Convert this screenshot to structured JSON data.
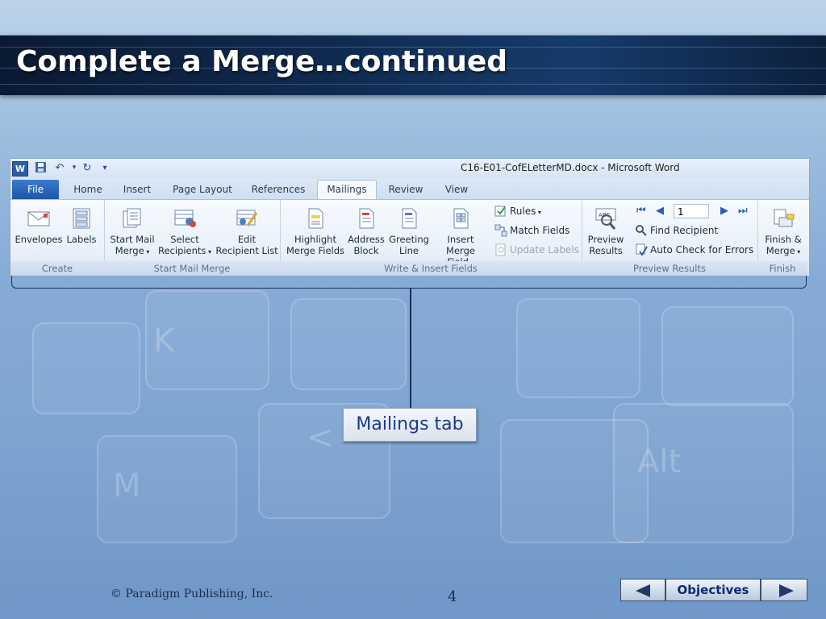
{
  "slide": {
    "title": "Complete a Merge…continued",
    "callout": "Mailings tab",
    "footer": "© Paradigm Publishing, Inc.",
    "page_number": "4",
    "nav": {
      "objectives_label": "Objectives",
      "prev_icon": "triangle-left-icon",
      "next_icon": "triangle-right-icon"
    }
  },
  "word": {
    "window_title": "C16-E01-CofELetterMD.docx - Microsoft Word",
    "qat_icons": [
      "word-app-icon",
      "save-icon",
      "undo-icon",
      "redo-icon",
      "customize-qat-icon"
    ],
    "tabs": [
      "File",
      "Home",
      "Insert",
      "Page Layout",
      "References",
      "Mailings",
      "Review",
      "View"
    ],
    "active_tab": "Mailings",
    "groups": {
      "create": {
        "label": "Create",
        "envelopes": "Envelopes",
        "labels": "Labels"
      },
      "start_mail_merge": {
        "label": "Start Mail Merge",
        "start_mail_merge": [
          "Start Mail",
          "Merge"
        ],
        "select_recipients": [
          "Select",
          "Recipients"
        ],
        "edit_recipient_list": [
          "Edit",
          "Recipient List"
        ]
      },
      "write_insert": {
        "label": "Write & Insert Fields",
        "highlight": [
          "Highlight",
          "Merge Fields"
        ],
        "address_block": [
          "Address",
          "Block"
        ],
        "greeting_line": [
          "Greeting",
          "Line"
        ],
        "insert_merge_field": [
          "Insert Merge",
          "Field"
        ],
        "rules": "Rules",
        "match_fields": "Match Fields",
        "update_labels": "Update Labels"
      },
      "preview": {
        "label": "Preview Results",
        "preview_results": [
          "Preview",
          "Results"
        ],
        "record": "1",
        "find_recipient": "Find Recipient",
        "auto_check": "Auto Check for Errors"
      },
      "finish": {
        "label": "Finish",
        "finish_merge": [
          "Finish &",
          "Merge"
        ]
      }
    }
  }
}
